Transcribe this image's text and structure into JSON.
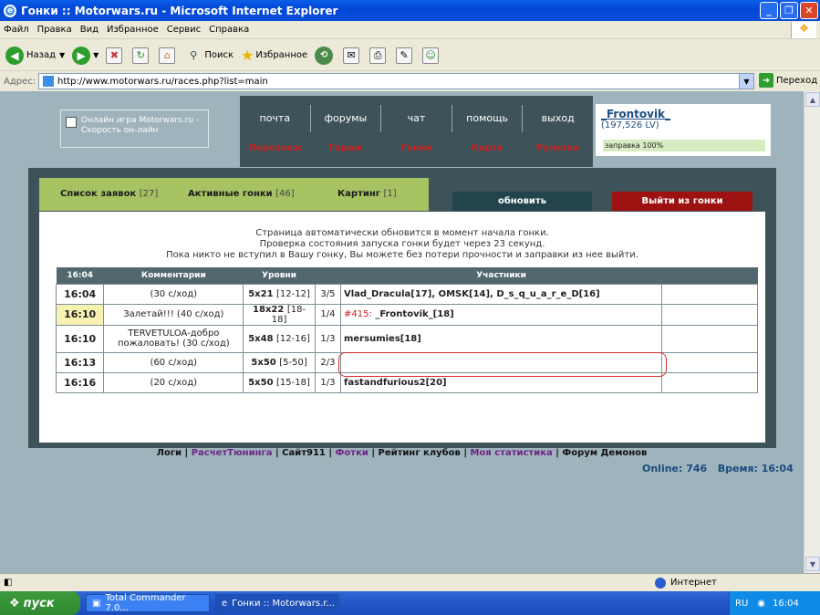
{
  "window": {
    "title": "Гонки :: Motorwars.ru - Microsoft Internet Explorer"
  },
  "menu": [
    "Файл",
    "Правка",
    "Вид",
    "Избранное",
    "Сервис",
    "Справка"
  ],
  "toolbar": {
    "back": "Назад",
    "search": "Поиск",
    "favorites": "Избранное"
  },
  "address": {
    "label": "Адрес:",
    "url": "http://www.motorwars.ru/races.php?list=main",
    "go": "Переход"
  },
  "site": {
    "logo_text": "Онлайн игра Motorwars.ru - Скорость он-лайн",
    "nav_top": [
      "почта",
      "форумы",
      "чат",
      "помощь",
      "выход"
    ],
    "nav_bottom": [
      "Персонаж",
      "Гараж",
      "Гонки",
      "Карта",
      "Рулетка"
    ],
    "user": {
      "name": "_Frontovik_",
      "lv": "(197,526 LV)",
      "fuel": "заправка 100%",
      "fuel_level": 1.0
    }
  },
  "tabs": [
    {
      "label": "Список заявок",
      "count": "[27]"
    },
    {
      "label": "Активные гонки",
      "count": "[46]"
    },
    {
      "label": "Картинг",
      "count": "[1]"
    }
  ],
  "buttons": {
    "update": "обновить",
    "exit_race": "Выйти из гонки"
  },
  "messages": [
    "Страница автоматически обновится в момент начала гонки.",
    "Проверка состояния запуска гонки будет через 23 секунд.",
    "Пока никто не вступил в Вашу гонку, Вы можете без потери прочности и заправки из нее выйти."
  ],
  "table": {
    "headers": [
      "16:04",
      "Комментарии",
      "Уровни",
      "",
      "Участники",
      ""
    ],
    "rows": [
      {
        "time": "16:04",
        "comment": "(30 с/ход)",
        "level": "5x21",
        "range": "[12-12]",
        "slots": "3/5",
        "participants": "Vlad_Dracula[17], OMSK[14], D_s_q_u_a_r_e_D[16]",
        "race_no": ""
      },
      {
        "time": "16:10",
        "comment": "Залетай!!! (40 с/ход)",
        "level": "18x22",
        "range": "[18-18]",
        "slots": "1/4",
        "participants": "_Frontovik_[18]",
        "race_no": "#415:"
      },
      {
        "time": "16:10",
        "comment": "TERVETULOA-добро пожаловать! (30 с/ход)",
        "level": "5x48",
        "range": "[12-16]",
        "slots": "1/3",
        "participants": "mersumies[18]",
        "race_no": ""
      },
      {
        "time": "16:13",
        "comment": "(60 с/ход)",
        "level": "5x50",
        "range": "[5-50]",
        "slots": "2/3",
        "participants": "",
        "race_no": ""
      },
      {
        "time": "16:16",
        "comment": "(20 с/ход)",
        "level": "5x50",
        "range": "[15-18]",
        "slots": "1/3",
        "participants": "fastandfurious2[20]",
        "race_no": ""
      }
    ]
  },
  "footer": {
    "links": [
      "Логи",
      "РасчетТюнинга",
      "Сайт911",
      "Фотки",
      "Рейтинг клубов",
      "Моя статистика",
      "Форум Демонов"
    ],
    "online": "Online: 746",
    "time": "Время: 16:04"
  },
  "status": {
    "zone": "Интернет"
  },
  "taskbar": {
    "start": "пуск",
    "tasks": [
      "Total Commander 7.0...",
      "Гонки :: Motorwars.r..."
    ],
    "lang": "RU",
    "clock": "16:04"
  },
  "colors": {
    "accent_green": "#a7c263",
    "panel": "#3e5359",
    "red": "#c72020",
    "bg": "#9eb3bb"
  }
}
